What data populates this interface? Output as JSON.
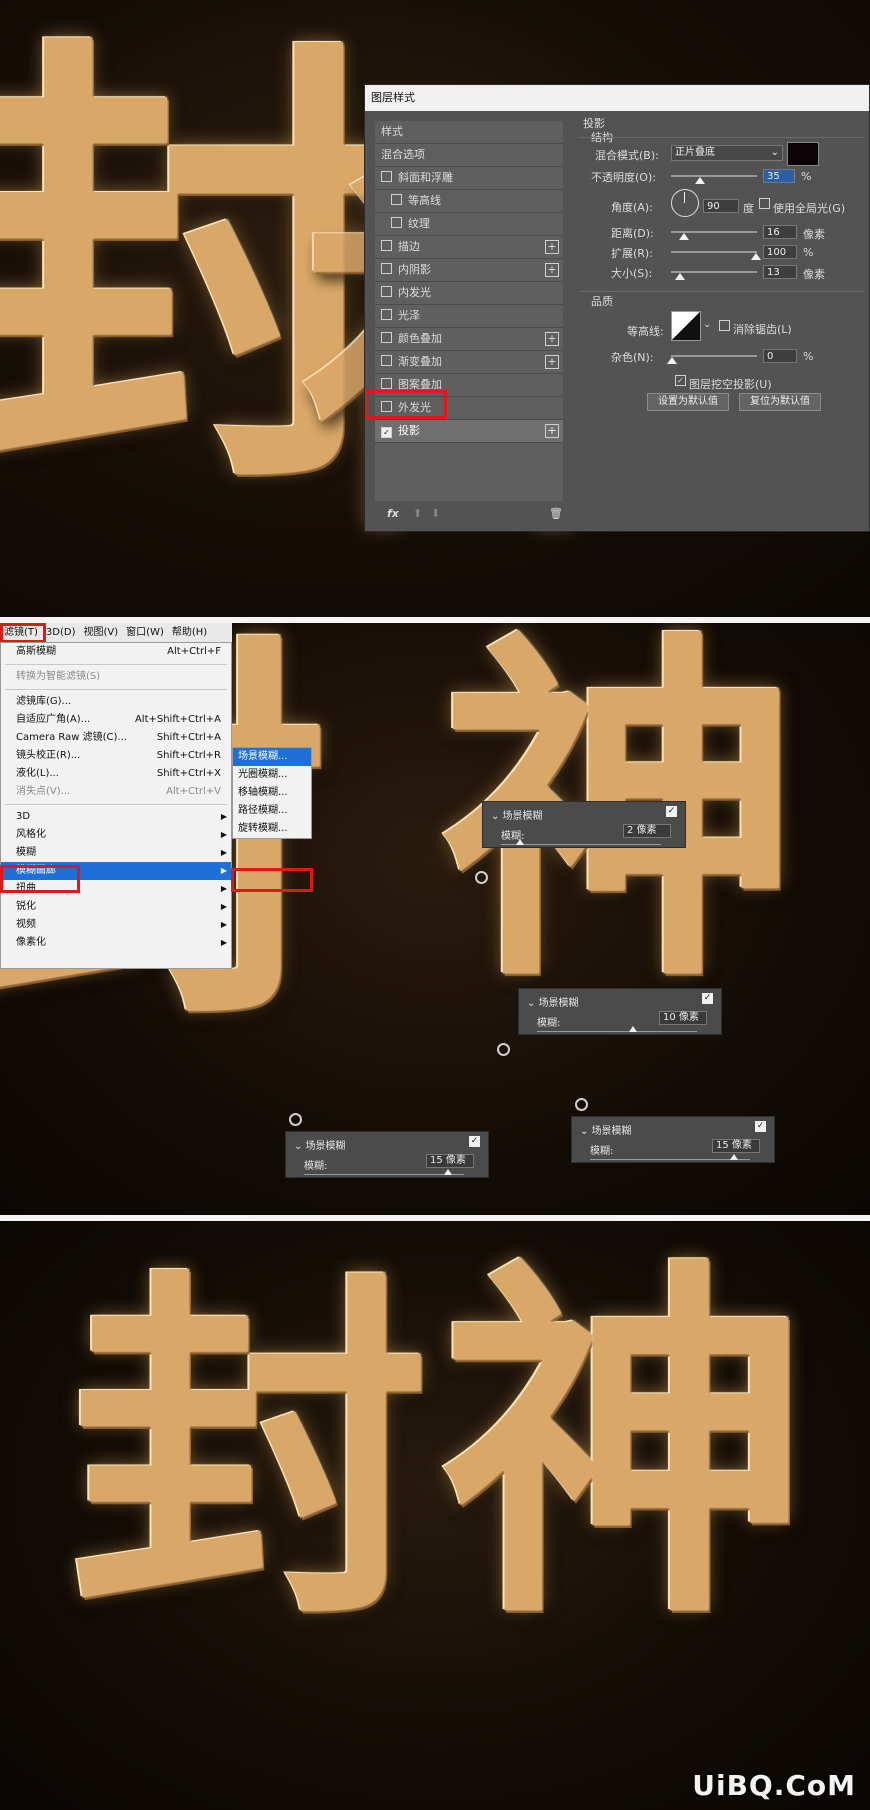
{
  "artwork": {
    "char1": "封",
    "char2": "神"
  },
  "dialog": {
    "title": "图层样式",
    "styles_header": "样式",
    "blend_options": "混合选项",
    "items": [
      {
        "label": "斜面和浮雕",
        "checked": false,
        "plus": false,
        "sub": false
      },
      {
        "label": "等高线",
        "checked": false,
        "plus": false,
        "sub": true
      },
      {
        "label": "纹理",
        "checked": false,
        "plus": false,
        "sub": true
      },
      {
        "label": "描边",
        "checked": false,
        "plus": true,
        "sub": false
      },
      {
        "label": "内阴影",
        "checked": false,
        "plus": true,
        "sub": false
      },
      {
        "label": "内发光",
        "checked": false,
        "plus": false,
        "sub": false
      },
      {
        "label": "光泽",
        "checked": false,
        "plus": false,
        "sub": false
      },
      {
        "label": "颜色叠加",
        "checked": false,
        "plus": true,
        "sub": false
      },
      {
        "label": "渐变叠加",
        "checked": false,
        "plus": true,
        "sub": false
      },
      {
        "label": "图案叠加",
        "checked": false,
        "plus": false,
        "sub": false
      },
      {
        "label": "外发光",
        "checked": false,
        "plus": false,
        "sub": false
      },
      {
        "label": "投影",
        "checked": true,
        "plus": true,
        "sub": false
      }
    ],
    "fx": "fx",
    "section_title": "投影",
    "structure": "结构",
    "blend_mode_label": "混合模式(B):",
    "blend_mode_value": "正片叠底",
    "shadow_color": "#0b0306",
    "opacity_label": "不透明度(O):",
    "opacity_value": "35",
    "angle_label": "角度(A):",
    "angle_value": "90",
    "degree": "度",
    "global_light": "使用全局光(G)",
    "distance_label": "距离(D):",
    "distance_value": "16",
    "spread_label": "扩展(R):",
    "spread_value": "100",
    "size_label": "大小(S):",
    "size_value": "13",
    "unit_px": "像素",
    "unit_pct": "%",
    "quality": "品质",
    "contour_label": "等高线:",
    "antialias": "消除锯齿(L)",
    "noise_label": "杂色(N):",
    "noise_value": "0",
    "knockout": "图层挖空投影(U)",
    "set_default": "设置为默认值",
    "reset_default": "复位为默认值"
  },
  "menubar": [
    "滤镜(T)",
    "3D(D)",
    "视图(V)",
    "窗口(W)",
    "帮助(H)"
  ],
  "filter_menu": {
    "groups": [
      [
        {
          "label": "高斯模糊",
          "shortcut": "Alt+Ctrl+F"
        }
      ],
      [
        {
          "label": "转换为智能滤镜(S)",
          "shortcut": "",
          "disabled": true
        }
      ],
      [
        {
          "label": "滤镜库(G)...",
          "shortcut": ""
        },
        {
          "label": "自适应广角(A)...",
          "shortcut": "Alt+Shift+Ctrl+A"
        },
        {
          "label": "Camera Raw 滤镜(C)...",
          "shortcut": "Shift+Ctrl+A"
        },
        {
          "label": "镜头校正(R)...",
          "shortcut": "Shift+Ctrl+R"
        },
        {
          "label": "液化(L)...",
          "shortcut": "Shift+Ctrl+X"
        },
        {
          "label": "消失点(V)...",
          "shortcut": "Alt+Ctrl+V",
          "disabled": true
        }
      ],
      [
        {
          "label": "3D",
          "sub": true
        },
        {
          "label": "风格化",
          "sub": true
        },
        {
          "label": "模糊",
          "sub": true
        },
        {
          "label": "模糊画廊",
          "sub": true,
          "highlight": true
        },
        {
          "label": "扭曲",
          "sub": true
        },
        {
          "label": "锐化",
          "sub": true
        },
        {
          "label": "视频",
          "sub": true
        },
        {
          "label": "像素化",
          "sub": true
        }
      ]
    ]
  },
  "submenu": [
    "场景模糊...",
    "光圈模糊...",
    "移轴模糊...",
    "路径模糊...",
    "旋转模糊..."
  ],
  "blur_widgets": [
    {
      "title": "场景模糊",
      "label": "模糊:",
      "value": "2 像素",
      "level": 0.02
    },
    {
      "title": "场景模糊",
      "label": "模糊:",
      "value": "10 像素",
      "level": 0.1
    },
    {
      "title": "场景模糊",
      "label": "模糊:",
      "value": "15 像素",
      "level": 0.15
    },
    {
      "title": "场景模糊",
      "label": "模糊:",
      "value": "15 像素",
      "level": 0.15
    }
  ],
  "watermark": "UiBQ.CoM"
}
